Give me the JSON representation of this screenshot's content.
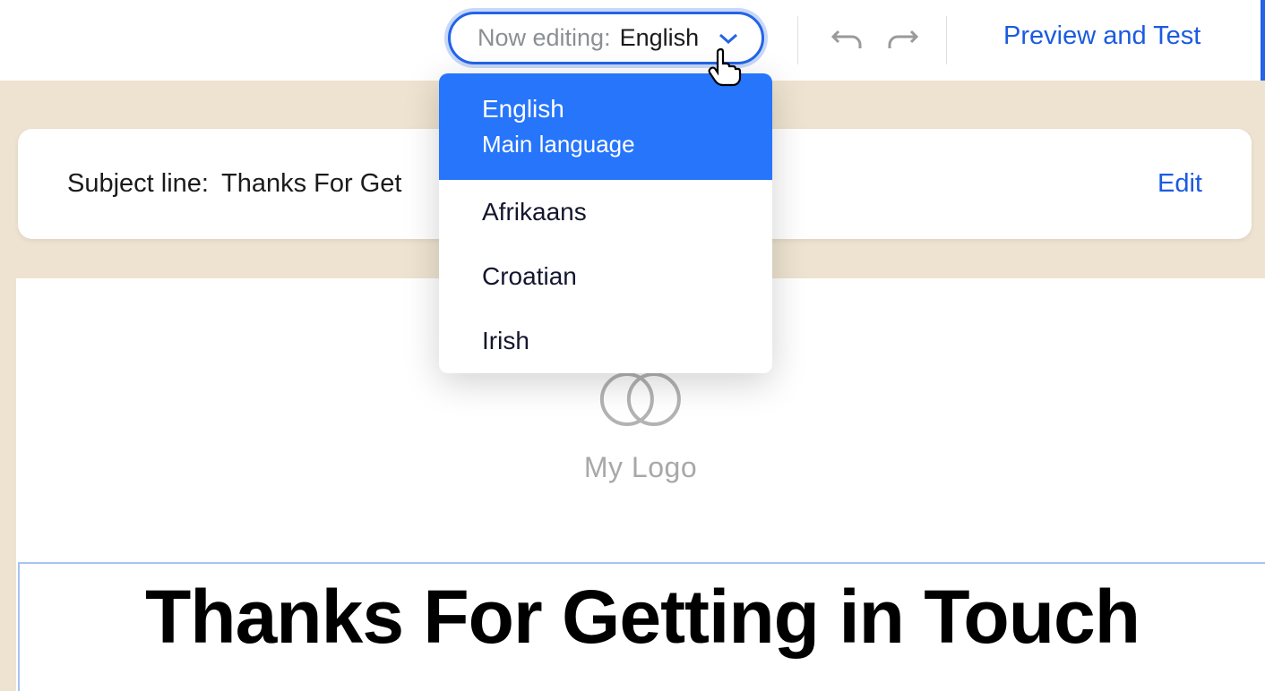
{
  "toolbar": {
    "language_selector": {
      "label": "Now editing:",
      "value": "English"
    },
    "preview_label": "Preview and Test"
  },
  "dropdown": {
    "items": [
      {
        "label": "English",
        "sub": "Main language",
        "selected": true
      },
      {
        "label": "Afrikaans",
        "selected": false
      },
      {
        "label": "Croatian",
        "selected": false
      },
      {
        "label": "Irish",
        "selected": false
      }
    ]
  },
  "subject": {
    "label": "Subject line:",
    "value": "Thanks For Get",
    "edit_label": "Edit"
  },
  "canvas": {
    "logo_text": "My Logo",
    "headline": "Thanks For Getting in Touch"
  }
}
